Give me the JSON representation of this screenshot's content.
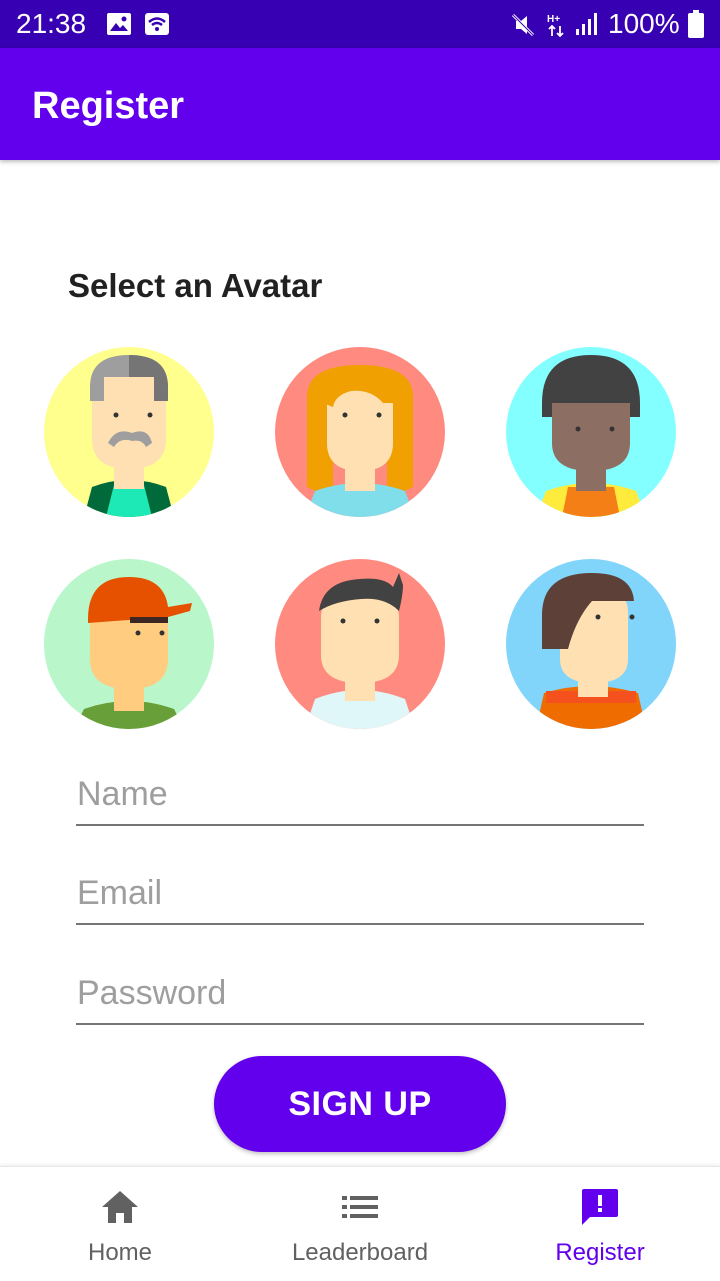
{
  "status_bar": {
    "time": "21:38",
    "battery": "100%"
  },
  "app_bar": {
    "title": "Register"
  },
  "avatar_section": {
    "title": "Select an Avatar"
  },
  "avatars": [
    {
      "name": "grandpa"
    },
    {
      "name": "blonde-woman"
    },
    {
      "name": "afro-man"
    },
    {
      "name": "cap-boy"
    },
    {
      "name": "dark-hair-boy"
    },
    {
      "name": "bob-hair-woman"
    }
  ],
  "form": {
    "name_placeholder": "Name",
    "email_placeholder": "Email",
    "password_placeholder": "Password",
    "signup_label": "SIGN UP"
  },
  "bottom_nav": {
    "items": [
      {
        "label": "Home",
        "icon": "home-icon",
        "active": false
      },
      {
        "label": "Leaderboard",
        "icon": "list-icon",
        "active": false
      },
      {
        "label": "Register",
        "icon": "feedback-icon",
        "active": true
      }
    ]
  },
  "colors": {
    "primary": "#6200ee",
    "primary_dark": "#3700b3"
  }
}
